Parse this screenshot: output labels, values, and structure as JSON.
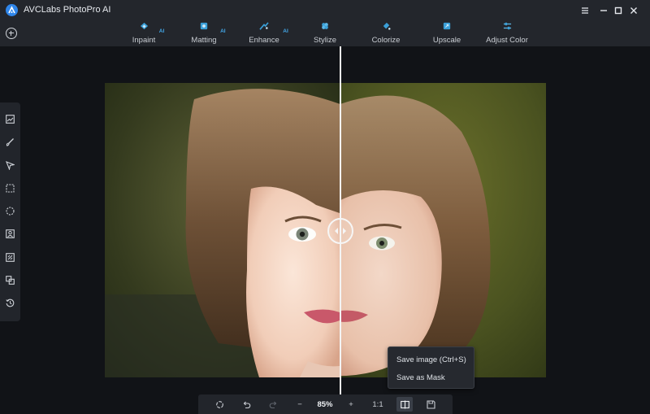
{
  "app": {
    "title": "AVCLabs PhotoPro AI"
  },
  "toolbar": {
    "tools": [
      {
        "label": "Inpaint",
        "ai": "AI",
        "icon": "inpaint-icon"
      },
      {
        "label": "Matting",
        "ai": "AI",
        "icon": "matting-icon"
      },
      {
        "label": "Enhance",
        "ai": "AI",
        "icon": "enhance-icon"
      },
      {
        "label": "Stylize",
        "ai": "",
        "icon": "stylize-icon"
      },
      {
        "label": "Colorize",
        "ai": "",
        "icon": "colorize-icon"
      },
      {
        "label": "Upscale",
        "ai": "",
        "icon": "upscale-icon"
      },
      {
        "label": "Adjust Color",
        "ai": "",
        "icon": "adjust-color-icon"
      }
    ],
    "accent": "#43a7e8"
  },
  "leftpanel": {
    "icons": [
      "image-icon",
      "brush-icon",
      "pointer-icon",
      "rect-select-icon",
      "ellipse-select-icon",
      "person-icon",
      "auto-select-icon",
      "layer-icon",
      "history-icon"
    ]
  },
  "context_menu": {
    "items": [
      "Save image (Ctrl+S)",
      "Save as Mask"
    ]
  },
  "bottombar": {
    "zoom": "85%",
    "ratio": "1:1",
    "minus": "−",
    "plus": "+"
  }
}
